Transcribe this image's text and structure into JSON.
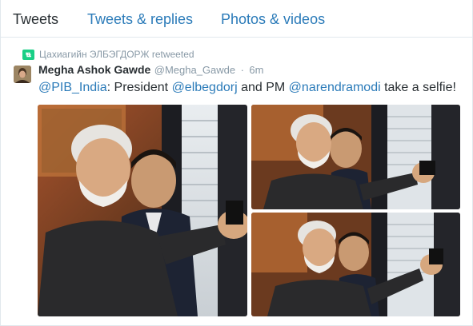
{
  "tabs": [
    {
      "label": "Tweets",
      "active": true
    },
    {
      "label": "Tweets & replies",
      "active": false
    },
    {
      "label": "Photos & videos",
      "active": false
    }
  ],
  "tweet": {
    "retweet_by": "Цахиагийн ЭЛБЭГДОРЖ retweeted",
    "retweet_icon": "retweet-icon",
    "author_name": "Megha Ashok Gawde",
    "author_handle": "@Megha_Gawde",
    "separator": "·",
    "time": "6m",
    "text": {
      "mention_1": "@PIB_India",
      "part_1": ": President ",
      "mention_2": "@elbegdorj",
      "part_2": " and PM ",
      "mention_3": "@narendramodi",
      "part_3": " take a selfie!"
    },
    "photos": [
      "photo-main",
      "photo-top-right",
      "photo-bottom-right"
    ]
  },
  "colors": {
    "link": "#2b7bb9",
    "text": "#292f33",
    "muted": "#8899a6",
    "retweet": "#19cf86",
    "border": "#e1e8ed"
  }
}
